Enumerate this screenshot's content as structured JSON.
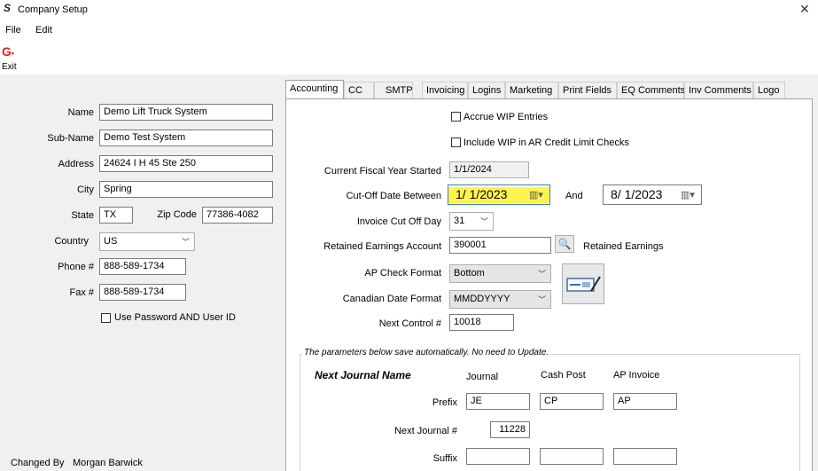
{
  "window": {
    "title": "Company Setup",
    "app_icon": "S",
    "close_glyph": "✕"
  },
  "menu": {
    "items": [
      "File",
      "Edit"
    ]
  },
  "toolbar": {
    "exit_label": "Exit"
  },
  "company": {
    "name_label": "Name",
    "name": "Demo Lift Truck System",
    "subname_label": "Sub-Name",
    "subname": "Demo Test System",
    "address_label": "Address",
    "address": "24624 I H 45 Ste 250",
    "city_label": "City",
    "city": "Spring",
    "state_label": "State",
    "state": "TX",
    "zip_label": "Zip Code",
    "zip": "77386-4082",
    "country_label": "Country",
    "country": "US",
    "phone_label": "Phone #",
    "phone": "888-589-1734",
    "fax_label": "Fax #",
    "fax": "888-589-1734",
    "use_password_label": "Use Password AND User ID",
    "changed_by_label": "Changed By",
    "changed_by": "Morgan Barwick"
  },
  "tabs": [
    "Accounting",
    "CC",
    "SMTP",
    "Invoicing",
    "Logins",
    "Marketing",
    "Print Fields",
    "EQ Comments",
    "Inv Comments",
    "Logo"
  ],
  "accounting": {
    "accrue_wip_label": "Accrue WIP Entries",
    "include_wip_label": "Include WIP in AR Credit Limit Checks",
    "fiscal_year_label": "Current Fiscal Year Started",
    "fiscal_year": "1/1/2024",
    "cutoff_label": "Cut-Off Date Between",
    "cutoff_start": "1/  1/2023",
    "and_label": "And",
    "cutoff_end": "8/  1/2023",
    "invoice_cutoff_label": "Invoice Cut Off Day",
    "invoice_cutoff": "31",
    "retained_label": "Retained Earnings Account",
    "retained_account": "390001",
    "retained_name": "Retained Earnings",
    "ap_check_label": "AP Check Format",
    "ap_check": "Bottom",
    "canadian_date_label": "Canadian Date Format",
    "canadian_date": "MMDDYYYY",
    "next_control_label": "Next Control #",
    "next_control": "10018",
    "highlight_color": "#fff44f"
  },
  "journal": {
    "note": "The parameters below save automatically.  No need to Update.",
    "heading": "Next Journal Name",
    "col_journal": "Journal",
    "col_cash_post": "Cash Post",
    "col_ap_invoice": "AP Invoice",
    "prefix_label": "Prefix",
    "prefix_journal": "JE",
    "prefix_cash_post": "CP",
    "prefix_ap_invoice": "AP",
    "next_journal_label": "Next Journal #",
    "next_journal": "11228",
    "suffix_label": "Suffix"
  }
}
